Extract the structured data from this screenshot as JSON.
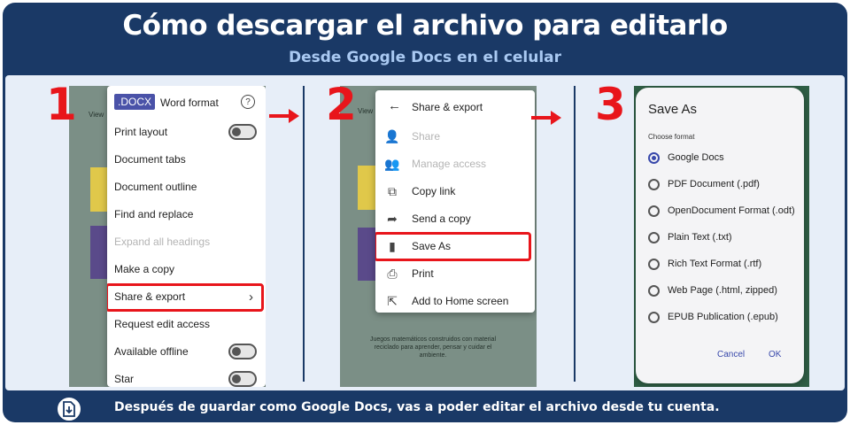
{
  "header": {
    "title": "Cómo descargar el archivo para editarlo",
    "subtitle": "Desde Google Docs en el celular"
  },
  "steps": [
    "1",
    "2",
    "3"
  ],
  "step1": {
    "doc_bg_text": "View",
    "format_badge": ".DOCX",
    "format_label": "Word format",
    "items": [
      {
        "label": "Print layout",
        "toggle": true
      },
      {
        "label": "Document tabs"
      },
      {
        "label": "Document outline"
      },
      {
        "label": "Find and replace"
      },
      {
        "label": "Expand all headings",
        "disabled": true
      },
      {
        "label": "Make a copy"
      },
      {
        "label": "Share & export",
        "chevron": "›",
        "highlighted": true
      },
      {
        "label": "Request edit access"
      },
      {
        "label": "Available offline",
        "toggle": true
      },
      {
        "label": "Star",
        "toggle": true
      }
    ]
  },
  "step2": {
    "doc_bg_text": "View",
    "doc_caption": "Juegos matemáticos construidos con material reciclado para aprender, pensar y cuidar el ambiente.",
    "header": "Share & export",
    "items": [
      {
        "label": "Share",
        "icon": "person-add-icon",
        "glyph": "👤",
        "disabled": true
      },
      {
        "label": "Manage access",
        "icon": "people-icon",
        "glyph": "👥",
        "disabled": true
      },
      {
        "label": "Copy link",
        "icon": "copy-icon",
        "glyph": "⧉"
      },
      {
        "label": "Send a copy",
        "icon": "share-arrow-icon",
        "glyph": "➦"
      },
      {
        "label": "Save As",
        "icon": "file-icon",
        "glyph": "▮",
        "highlighted": true
      },
      {
        "label": "Print",
        "icon": "printer-icon",
        "glyph": "⎙"
      },
      {
        "label": "Add to Home screen",
        "icon": "home-screen-icon",
        "glyph": "⇱"
      }
    ]
  },
  "step3": {
    "title": "Save As",
    "choose_label": "Choose format",
    "options": [
      {
        "label": "Google Docs",
        "selected": true
      },
      {
        "label": "PDF Document (.pdf)"
      },
      {
        "label": "OpenDocument Format (.odt)"
      },
      {
        "label": "Plain Text (.txt)"
      },
      {
        "label": "Rich Text Format (.rtf)"
      },
      {
        "label": "Web Page (.html, zipped)"
      },
      {
        "label": "EPUB Publication (.epub)"
      }
    ],
    "cancel": "Cancel",
    "ok": "OK"
  },
  "footer": {
    "text": "Después de guardar como Google Docs, vas a poder editar el archivo desde tu cuenta."
  },
  "colors": {
    "navy": "#1a3966",
    "red": "#e8151b",
    "panel": "#e7eef8",
    "accent": "#3949ab"
  }
}
